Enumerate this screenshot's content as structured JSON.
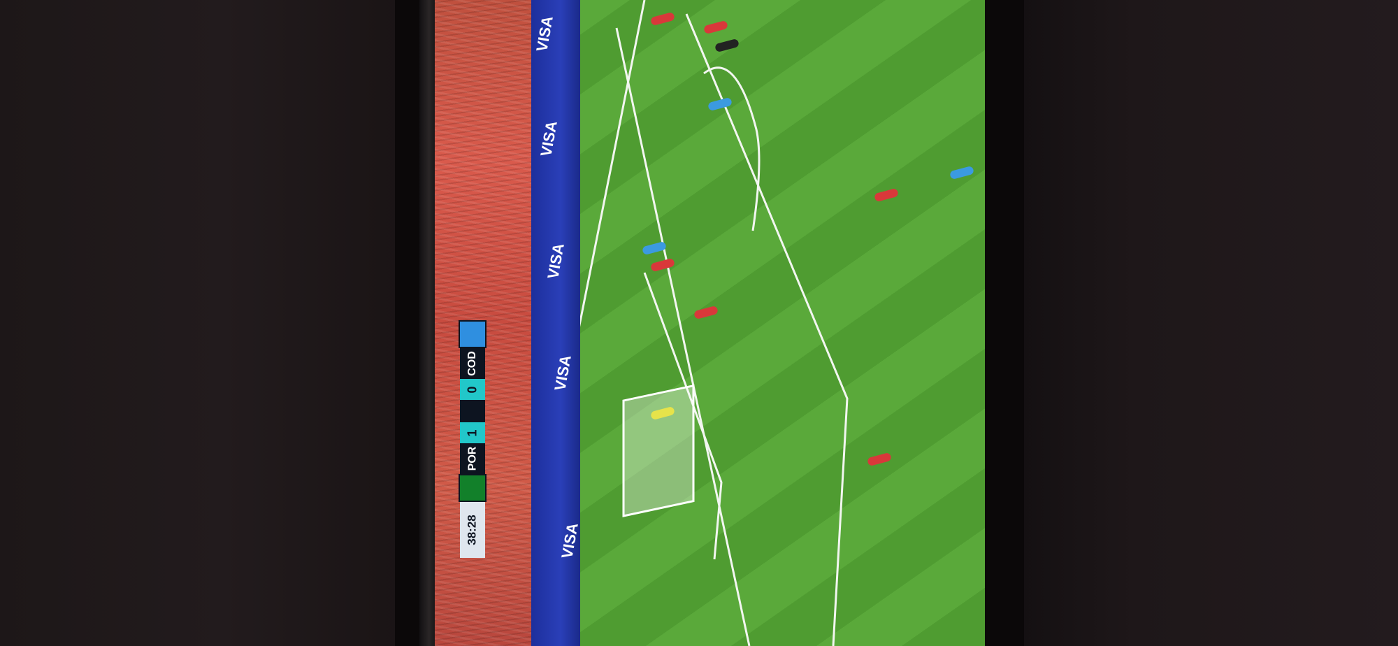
{
  "broadcast": {
    "clock": "38:28",
    "home_team": "POR",
    "away_team": "COD",
    "home_score": "1",
    "away_score": "0",
    "score_separator": "",
    "sponsor": "VISA"
  },
  "colors": {
    "pitch_light": "#5aa93a",
    "pitch_dark": "#4f9c31",
    "ad_board": "#2a3fb8",
    "crowd": "#d05a48",
    "scoreboard_bg": "#0d1420",
    "score_accent": "#22c7c9"
  },
  "icons": {
    "home_flag": "portugal-flag-icon",
    "away_flag": "dr-congo-flag-icon"
  }
}
